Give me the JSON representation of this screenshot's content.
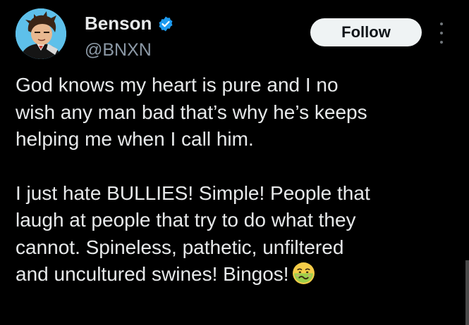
{
  "author": {
    "name": "Benson",
    "handle": "@BNXN",
    "verified": true,
    "avatar_icon": "cartoon-avatar-icon"
  },
  "actions": {
    "follow_label": "Follow",
    "more_icon": "more-vertical-icon"
  },
  "tweet": {
    "paragraph_1": "God knows my heart is pure and I no\nwish any man bad that’s why he’s keeps\nhelping me when I call him.",
    "paragraph_2": "I just hate BULLIES! Simple! People that\nlaugh at people that try to do what they\ncannot. Spineless, pathetic, unfiltered\nand uncultured swines! Bingos!",
    "emoji_icon": "nauseated-face-emoji-icon"
  },
  "colors": {
    "background": "#000000",
    "text": "#e7e9ea",
    "secondary_text": "#8b98a5",
    "verified_blue": "#1d9bf0",
    "follow_bg": "#eff3f4",
    "follow_text": "#0f1419"
  }
}
